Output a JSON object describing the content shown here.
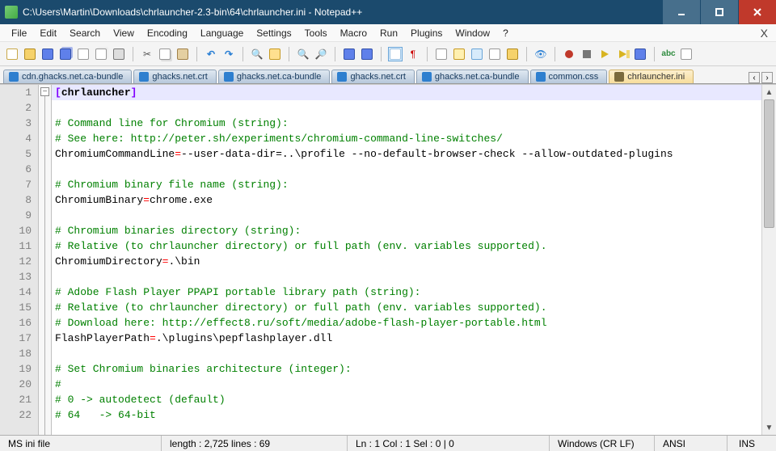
{
  "titlebar": {
    "title": "C:\\Users\\Martin\\Downloads\\chrlauncher-2.3-bin\\64\\chrlauncher.ini - Notepad++"
  },
  "menu": {
    "file": "File",
    "edit": "Edit",
    "search": "Search",
    "view": "View",
    "encoding": "Encoding",
    "language": "Language",
    "settings": "Settings",
    "tools": "Tools",
    "macro": "Macro",
    "run": "Run",
    "plugins": "Plugins",
    "window": "Window",
    "help": "?"
  },
  "tabs": [
    {
      "label": "cdn.ghacks.net.ca-bundle",
      "active": false
    },
    {
      "label": "ghacks.net.crt",
      "active": false
    },
    {
      "label": "ghacks.net.ca-bundle",
      "active": false
    },
    {
      "label": "ghacks.net.crt",
      "active": false
    },
    {
      "label": "ghacks.net.ca-bundle",
      "active": false
    },
    {
      "label": "common.css",
      "active": false
    },
    {
      "label": "chrlauncher.ini",
      "active": true
    }
  ],
  "code": {
    "lines": [
      {
        "n": 1,
        "type": "section",
        "raw": "[chrlauncher]"
      },
      {
        "n": 2,
        "type": "blank"
      },
      {
        "n": 3,
        "type": "comment",
        "raw": "# Command line for Chromium (string):"
      },
      {
        "n": 4,
        "type": "comment",
        "raw": "# See here: http://peter.sh/experiments/chromium-command-line-switches/"
      },
      {
        "n": 5,
        "type": "kv",
        "key": "ChromiumCommandLine",
        "val": "--user-data-dir=..\\profile --no-default-browser-check --allow-outdated-plugins"
      },
      {
        "n": 6,
        "type": "blank"
      },
      {
        "n": 7,
        "type": "comment",
        "raw": "# Chromium binary file name (string):"
      },
      {
        "n": 8,
        "type": "kv",
        "key": "ChromiumBinary",
        "val": "chrome.exe"
      },
      {
        "n": 9,
        "type": "blank"
      },
      {
        "n": 10,
        "type": "comment",
        "raw": "# Chromium binaries directory (string):"
      },
      {
        "n": 11,
        "type": "comment",
        "raw": "# Relative (to chrlauncher directory) or full path (env. variables supported)."
      },
      {
        "n": 12,
        "type": "kv",
        "key": "ChromiumDirectory",
        "val": ".\\bin"
      },
      {
        "n": 13,
        "type": "blank"
      },
      {
        "n": 14,
        "type": "comment",
        "raw": "# Adobe Flash Player PPAPI portable library path (string):"
      },
      {
        "n": 15,
        "type": "comment",
        "raw": "# Relative (to chrlauncher directory) or full path (env. variables supported)."
      },
      {
        "n": 16,
        "type": "comment",
        "raw": "# Download here: http://effect8.ru/soft/media/adobe-flash-player-portable.html"
      },
      {
        "n": 17,
        "type": "kv",
        "key": "FlashPlayerPath",
        "val": ".\\plugins\\pepflashplayer.dll"
      },
      {
        "n": 18,
        "type": "blank"
      },
      {
        "n": 19,
        "type": "comment",
        "raw": "# Set Chromium binaries architecture (integer):"
      },
      {
        "n": 20,
        "type": "comment",
        "raw": "#"
      },
      {
        "n": 21,
        "type": "comment",
        "raw": "# 0 -> autodetect (default)"
      },
      {
        "n": 22,
        "type": "comment",
        "raw": "# 64   -> 64-bit"
      }
    ]
  },
  "status": {
    "filetype": "MS ini file",
    "length": "length : 2,725    lines : 69",
    "pos": "Ln : 1    Col : 1    Sel : 0 | 0",
    "eol": "Windows (CR LF)",
    "encoding": "ANSI",
    "mode": "INS"
  }
}
